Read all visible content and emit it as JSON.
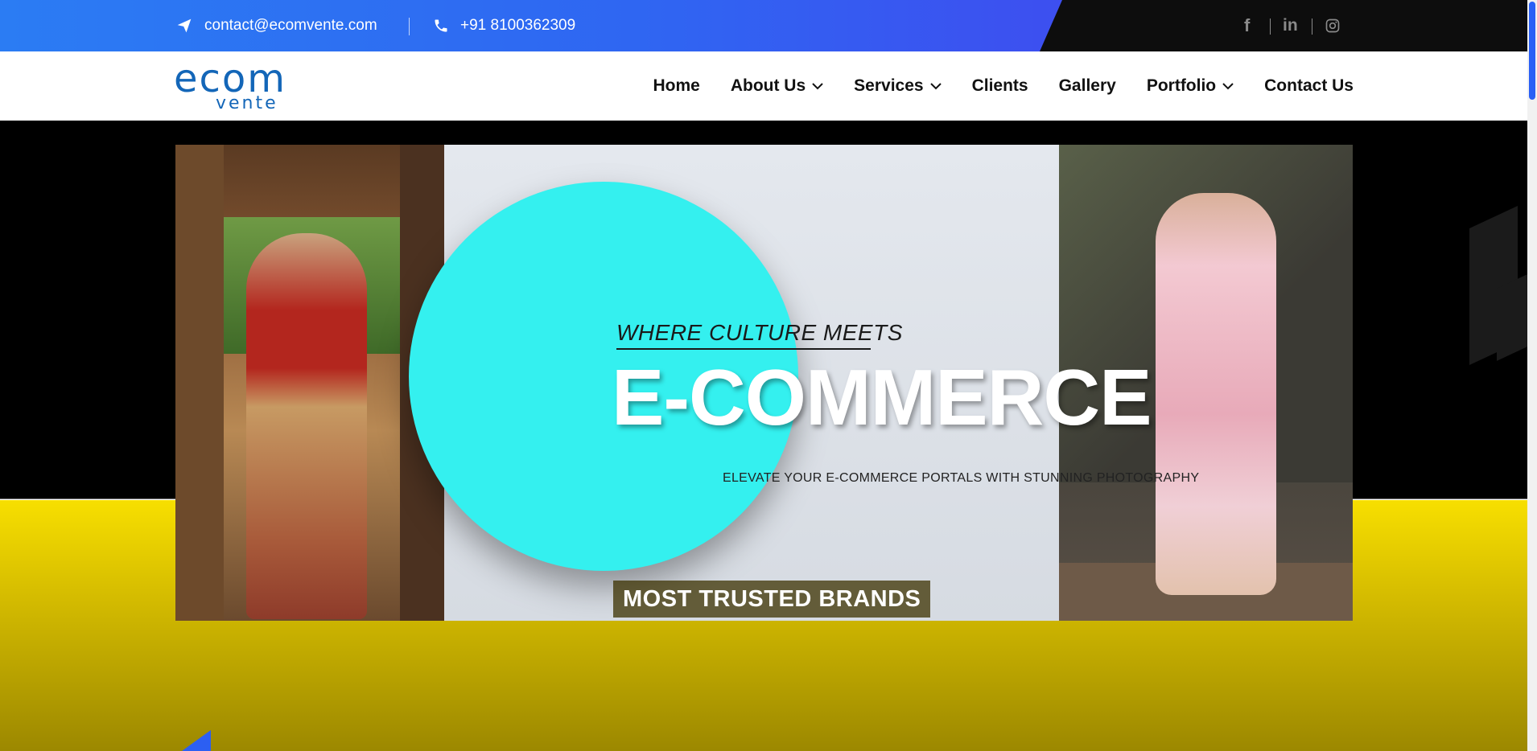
{
  "topbar": {
    "email": "contact@ecomvente.com",
    "phone": "+91 8100362309",
    "social": [
      {
        "icon": "facebook-icon",
        "glyph": "f"
      },
      {
        "icon": "linkedin-icon",
        "glyph": "in"
      },
      {
        "icon": "instagram-icon"
      }
    ]
  },
  "brand": {
    "logo_word": "ecom",
    "logo_sub": "vente",
    "color": "#1366b8"
  },
  "nav": {
    "items": [
      {
        "label": "Home",
        "dropdown": false
      },
      {
        "label": "About Us",
        "dropdown": true
      },
      {
        "label": "Services",
        "dropdown": true
      },
      {
        "label": "Clients",
        "dropdown": false
      },
      {
        "label": "Gallery",
        "dropdown": false
      },
      {
        "label": "Portfolio",
        "dropdown": true
      },
      {
        "label": "Contact Us",
        "dropdown": false
      }
    ]
  },
  "hero": {
    "kicker": "WHERE CULTURE MEETS",
    "title": "E-COMMERCE",
    "subtitle": "ELEVATE YOUR E-COMMERCE PORTALS WITH STUNNING PHOTOGRAPHY",
    "accent_color": "#34f0ef"
  },
  "brands": {
    "title": "MOST TRUSTED BRANDS"
  },
  "colors": {
    "topbar_blue": "#2f66f2",
    "topbar_dark": "#0d0d0d",
    "hero_yellow": "#f7df00"
  }
}
